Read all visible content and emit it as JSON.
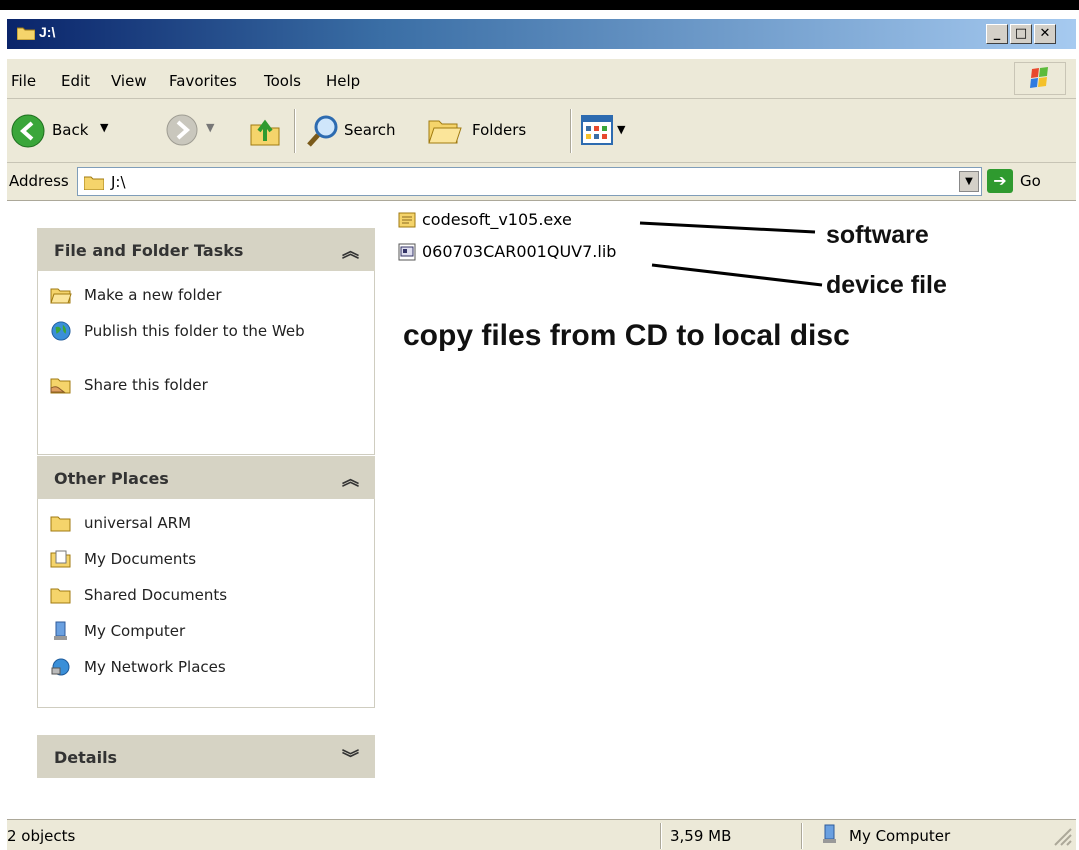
{
  "window": {
    "title": "J:\\"
  },
  "menu": [
    "File",
    "Edit",
    "View",
    "Favorites",
    "Tools",
    "Help"
  ],
  "toolbar": {
    "back_label": "Back",
    "search_label": "Search",
    "folders_label": "Folders"
  },
  "address": {
    "label": "Address",
    "value": "J:\\",
    "go_label": "Go"
  },
  "panels": {
    "tasks": {
      "title": "File and Folder Tasks",
      "items": [
        "Make a new folder",
        "Publish this folder to the Web",
        "Share this folder"
      ]
    },
    "places": {
      "title": "Other Places",
      "items": [
        "universal ARM",
        "My Documents",
        "Shared Documents",
        "My Computer",
        "My Network Places"
      ]
    },
    "details": {
      "title": "Details"
    }
  },
  "files": [
    "codesoft_v105.exe",
    "060703CAR001QUV7.lib"
  ],
  "annotations": {
    "software": "software",
    "device": "device file",
    "copy": "copy files from CD to local disc"
  },
  "status": {
    "objects": "2 objects",
    "size": "3,59 MB",
    "location": "My Computer"
  },
  "colors": {
    "titlebar_start": "#0a246a",
    "titlebar_end": "#a6caf0",
    "chrome": "#ece9d8",
    "panel_header": "#d6d3c4",
    "go_green": "#2f9a2f"
  }
}
